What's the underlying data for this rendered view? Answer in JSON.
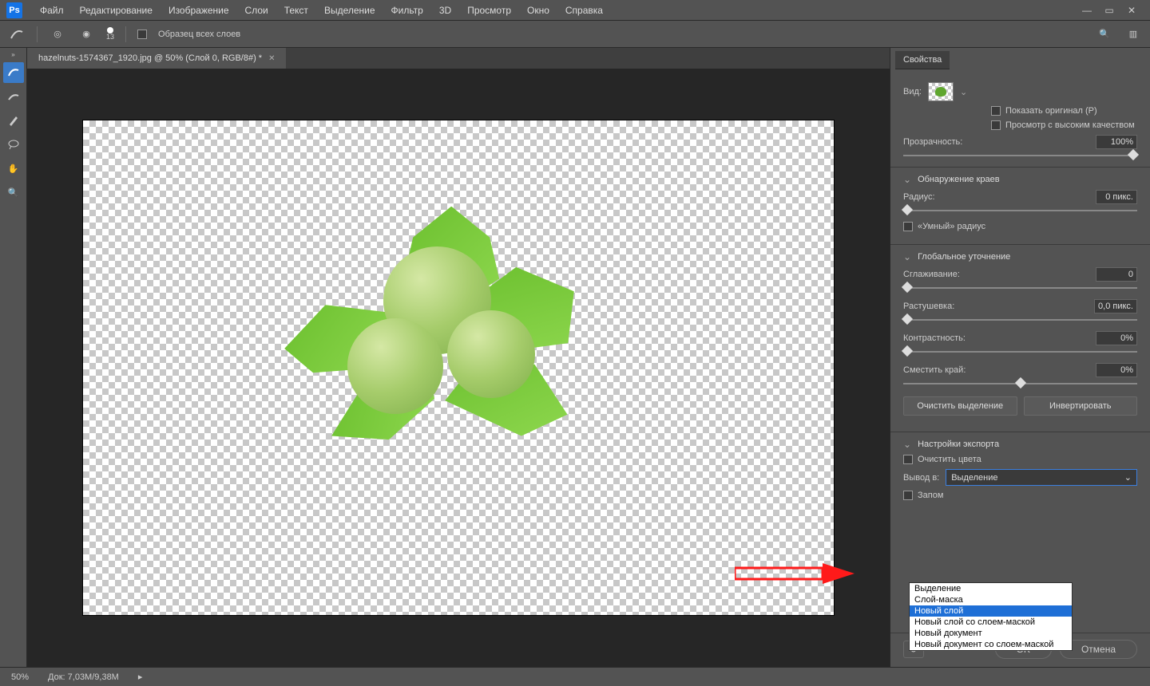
{
  "menu": {
    "items": [
      "Файл",
      "Редактирование",
      "Изображение",
      "Слои",
      "Текст",
      "Выделение",
      "Фильтр",
      "3D",
      "Просмотр",
      "Окно",
      "Справка"
    ]
  },
  "optbar": {
    "brush_size": "13",
    "sample_all": "Образец всех слоев"
  },
  "tab": {
    "title": "hazelnuts-1574367_1920.jpg @ 50% (Слой 0, RGB/8#) *"
  },
  "panel": {
    "title": "Свойства",
    "view_label": "Вид:",
    "show_original": "Показать оригинал (P)",
    "high_quality": "Просмотр с высоким качеством",
    "opacity_label": "Прозрачность:",
    "opacity_value": "100%",
    "edge_section": "Обнаружение краев",
    "radius_label": "Радиус:",
    "radius_value": "0 пикс.",
    "smart_radius": "«Умный» радиус",
    "global_section": "Глобальное уточнение",
    "smooth_label": "Сглаживание:",
    "smooth_value": "0",
    "feather_label": "Растушевка:",
    "feather_value": "0,0 пикс.",
    "contrast_label": "Контрастность:",
    "contrast_value": "0%",
    "shift_label": "Сместить край:",
    "shift_value": "0%",
    "clear_sel": "Очистить выделение",
    "invert": "Инвертировать",
    "export_section": "Настройки экспорта",
    "decontaminate": "Очистить цвета",
    "output_label": "Вывод в:",
    "output_value": "Выделение",
    "remember_partial": "Запом",
    "dropdown": [
      "Выделение",
      "Слой-маска",
      "Новый слой",
      "Новый слой со слоем-маской",
      "Новый документ",
      "Новый документ со слоем-маской"
    ],
    "ok": "OK",
    "cancel": "Отмена"
  },
  "status": {
    "zoom": "50%",
    "doc": "Док: 7,03M/9,38M"
  }
}
